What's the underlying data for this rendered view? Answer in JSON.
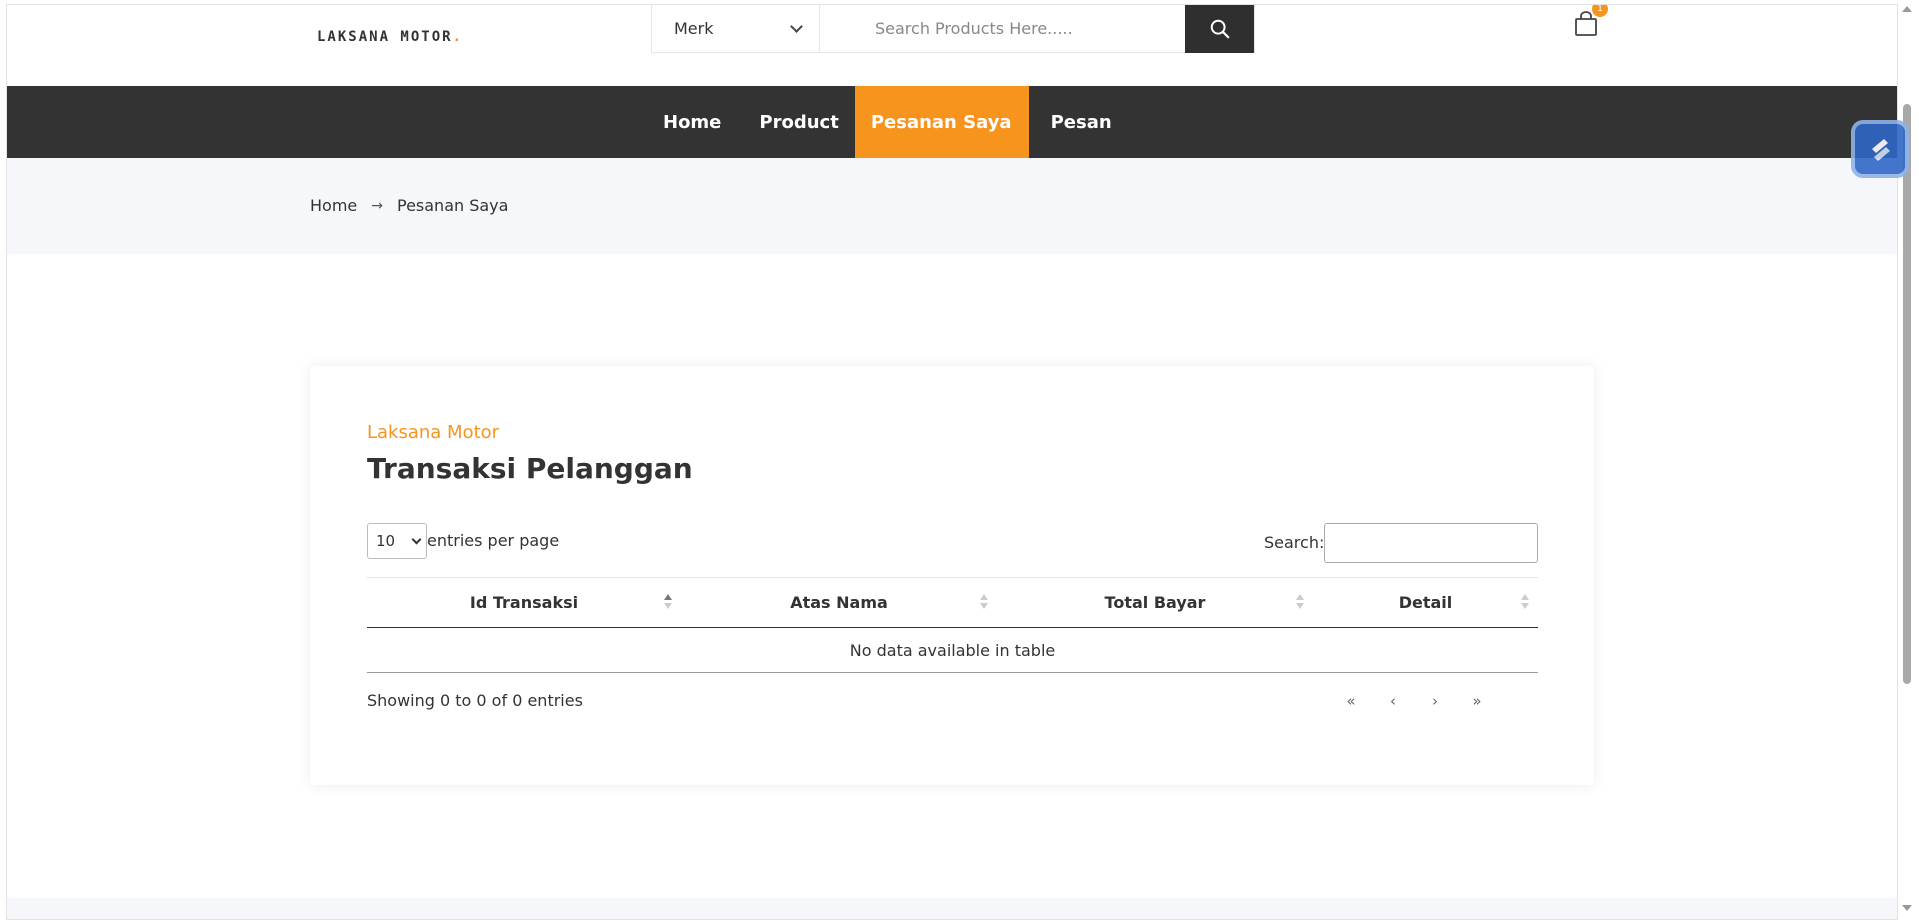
{
  "header": {
    "logo_text": "LAKSANA MOTOR",
    "logo_dot": ".",
    "brand_select_value": "Merk",
    "search_placeholder": "Search Products Here.....",
    "cart_count": "1"
  },
  "nav": {
    "items": [
      {
        "label": "Home"
      },
      {
        "label": "Product"
      },
      {
        "label": "Pesanan Saya"
      },
      {
        "label": "Pesan"
      }
    ],
    "active_index": 2
  },
  "breadcrumb": {
    "home": "Home",
    "separator": "→",
    "current": "Pesanan Saya"
  },
  "card": {
    "subtitle": "Laksana Motor",
    "title": "Transaksi Pelanggan",
    "entries_value": "10",
    "entries_label": "entries per page",
    "search_label": "Search:",
    "columns": [
      "Id Transaksi",
      "Atas Nama",
      "Total Bayar",
      "Detail"
    ],
    "empty_message": "No data available in table",
    "info": "Showing 0 to 0 of 0 entries",
    "pager": [
      "«",
      "‹",
      "›",
      "»"
    ]
  },
  "colors": {
    "accent": "#f7941d",
    "nav_bg": "#333333",
    "breadcrumb_bg": "#f5f7fa"
  }
}
